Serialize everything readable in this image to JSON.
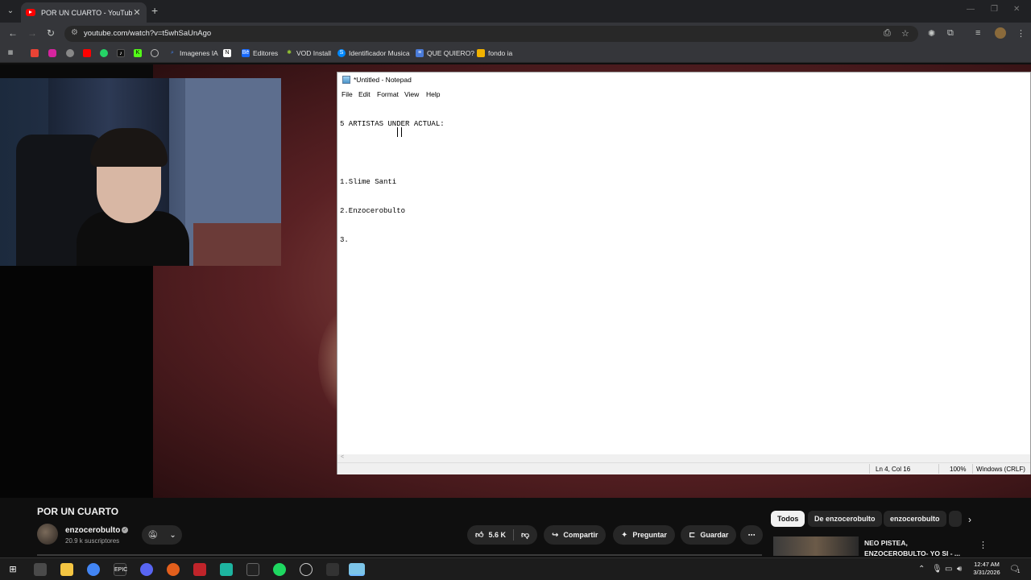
{
  "browser": {
    "tab_title": "POR UN CUARTO - YouTube",
    "url": "youtube.com/watch?v=t5whSaUnAgo",
    "bookmarks": [
      {
        "label": "",
        "icon": "gmail-icon",
        "color": "#ea4335"
      },
      {
        "label": "",
        "icon": "instagram-icon",
        "color": "#d6249f"
      },
      {
        "label": "",
        "icon": "generic-icon",
        "color": "#888888"
      },
      {
        "label": "",
        "icon": "youtube-icon",
        "color": "#ff0000"
      },
      {
        "label": "",
        "icon": "whatsapp-icon",
        "color": "#25d366"
      },
      {
        "label": "",
        "icon": "tiktok-icon",
        "color": "#111111"
      },
      {
        "label": "",
        "icon": "kick-icon",
        "color": "#53fc18"
      },
      {
        "label": "",
        "icon": "globe-icon",
        "color": "#555555"
      },
      {
        "label": "Imagenes IA",
        "icon": "search-icon",
        "color": "#4285f4"
      },
      {
        "label": "",
        "icon": "notion-icon",
        "color": "#ffffff"
      },
      {
        "label": "Editores",
        "icon": "behance-icon",
        "color": "#1769ff"
      },
      {
        "label": "VOD Install",
        "icon": "vod-icon",
        "color": "#9acd32"
      },
      {
        "label": "Identificador Musica",
        "icon": "shazam-icon",
        "color": "#0088ff"
      },
      {
        "label": "QUE QUIERO?",
        "icon": "doc-icon",
        "color": "#4a7bd8"
      },
      {
        "label": "fondo ia",
        "icon": "folder-icon",
        "color": "#f2b300"
      }
    ]
  },
  "notepad": {
    "title": "*Untitled - Notepad",
    "menu": [
      "File",
      "Edit",
      "Format",
      "View",
      "Help"
    ],
    "lines": [
      "5 ARTISTAS UNDER ACTUAL:",
      "",
      "1.Slime Santi",
      "2.Enzocerobulto",
      "3."
    ],
    "status": {
      "position": "Ln 4, Col 16",
      "zoom": "100%",
      "encoding": "Windows (CRLF)"
    }
  },
  "youtube": {
    "video_title": "POR UN CUARTO",
    "channel_name": "enzocerobulto",
    "subscribers": "20.9 k suscriptores",
    "likes": "5.6 K",
    "share_label": "Compartir",
    "ask_label": "Preguntar",
    "save_label": "Guardar",
    "chips": [
      "Todos",
      "De enzocerobulto",
      "enzocerobulto"
    ],
    "recommendation_title": "NEO PISTEA, ENZOCEROBULTO- YO SI - ..."
  },
  "taskbar": {
    "time": "12:47 AM",
    "date": "3/31/2026",
    "notification_count": "1"
  }
}
